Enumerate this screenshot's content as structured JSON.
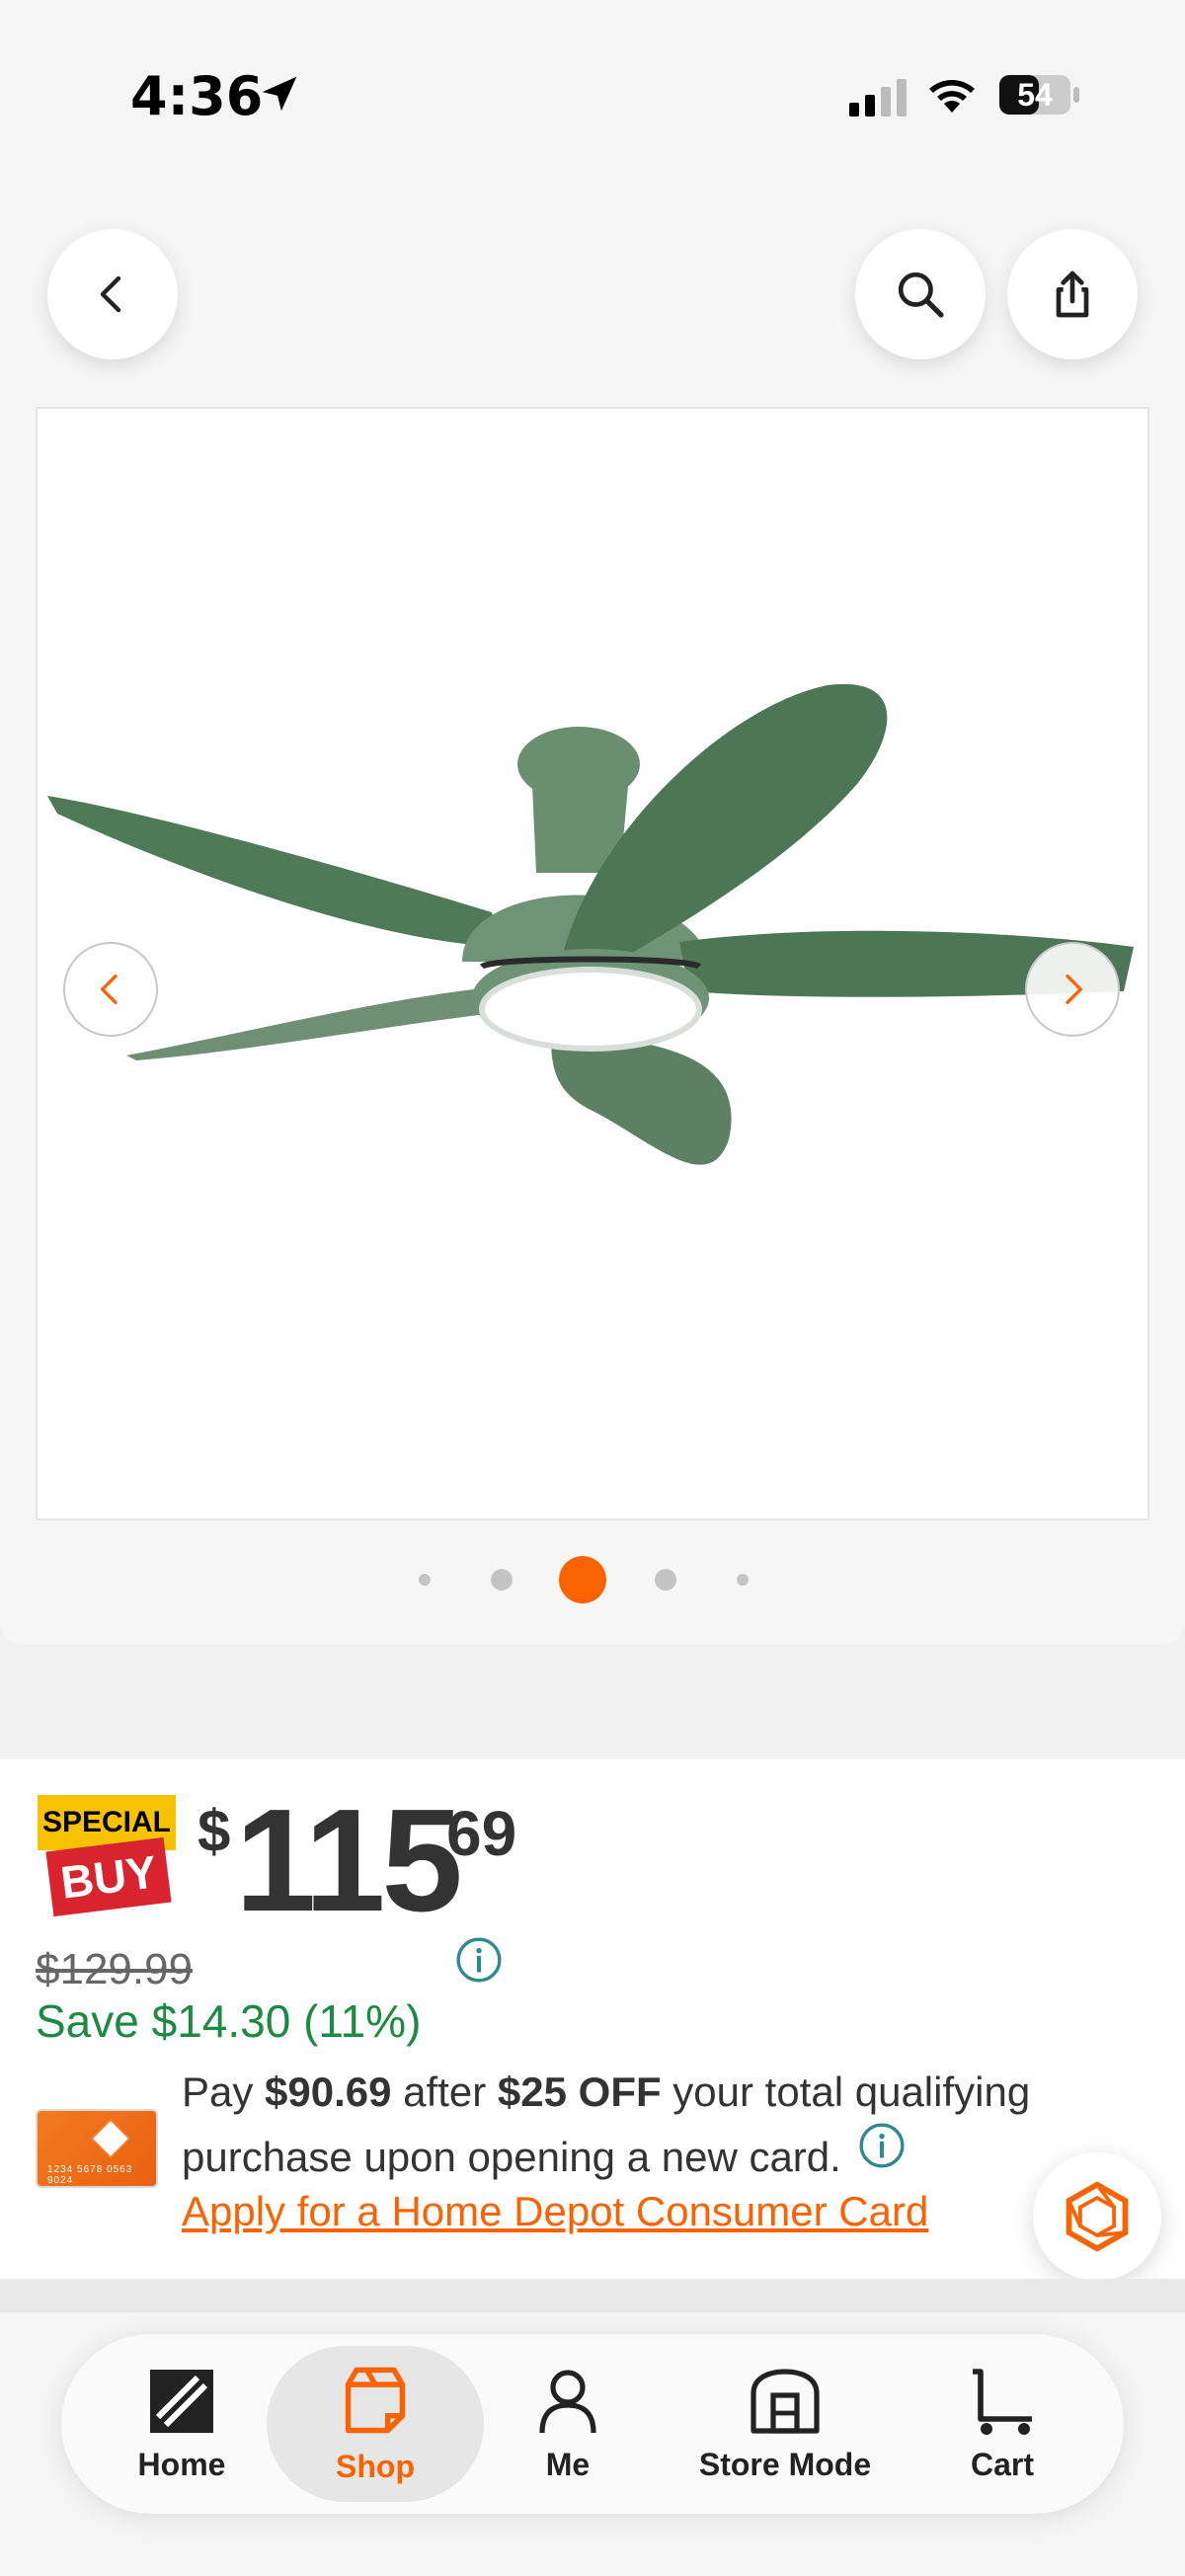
{
  "status_bar": {
    "time": "4:36",
    "battery": "54"
  },
  "product": {
    "badge_top": "SPECIAL",
    "badge_bottom": "BUY",
    "price_dollar_sign": "$",
    "price_whole": "115",
    "price_cents": "69",
    "was_price": "$129.99",
    "save_text": "Save $14.30 (11%)",
    "gallery_count": 5,
    "gallery_active_index": 2
  },
  "promo": {
    "pay_prefix": "Pay ",
    "pay_amount": "$90.69",
    "after": " after ",
    "off_amount": "$25 OFF",
    "rest": " your total qualifying purchase upon opening a new card.",
    "apply_link": "Apply for a Home Depot Consumer Card",
    "card_number": "1234 5678 0563 9024"
  },
  "nav": {
    "items": [
      {
        "label": "Home",
        "icon": "home-depot-logo-icon"
      },
      {
        "label": "Shop",
        "icon": "shop-icon"
      },
      {
        "label": "Me",
        "icon": "person-icon"
      },
      {
        "label": "Store Mode",
        "icon": "store-icon"
      },
      {
        "label": "Cart",
        "icon": "cart-icon"
      }
    ],
    "active": "Shop"
  },
  "colors": {
    "accent": "#f96302",
    "save_green": "#1c8a43",
    "badge_yellow": "#f7c200",
    "badge_red": "#d9232e",
    "fan_green": "#4e7a57"
  }
}
